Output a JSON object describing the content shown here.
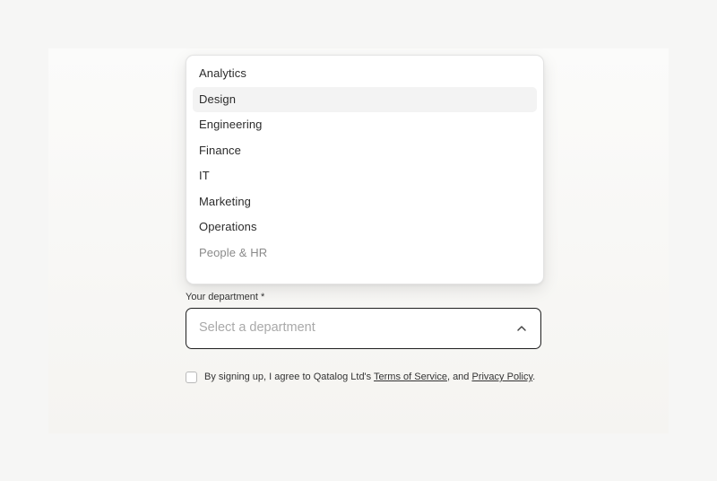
{
  "dropdown": {
    "options": [
      "Analytics",
      "Design",
      "Engineering",
      "Finance",
      "IT",
      "Marketing",
      "Operations",
      "People & HR"
    ],
    "highlighted": "Design"
  },
  "department": {
    "label": "Your department *",
    "placeholder": "Select a department"
  },
  "consent": {
    "prefix": "By signing up, I agree to Qatalog Ltd's ",
    "terms_link": "Terms of Service",
    "middle": ", and ",
    "privacy_link": "Privacy Policy",
    "suffix": "."
  }
}
